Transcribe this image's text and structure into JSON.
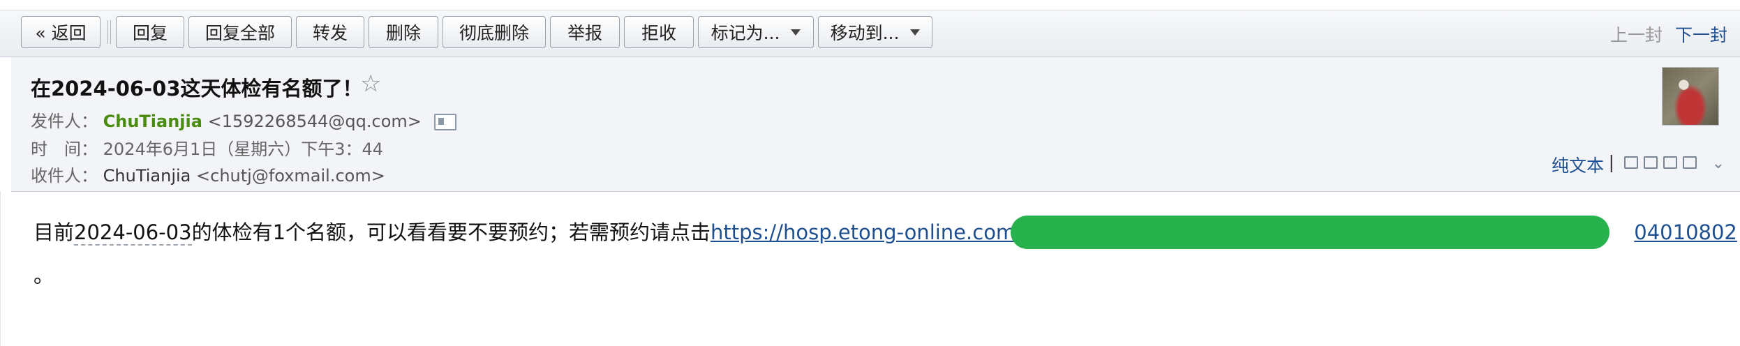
{
  "toolbar": {
    "back_label": "« 返回",
    "reply_label": "回复",
    "reply_all_label": "回复全部",
    "forward_label": "转发",
    "delete_label": "删除",
    "delete_forever_label": "彻底删除",
    "report_label": "举报",
    "reject_label": "拒收",
    "mark_as_label": "标记为...",
    "move_to_label": "移动到...",
    "prev_label": "上一封",
    "next_label": "下一封"
  },
  "email": {
    "subject": "在2024-06-03这天体检有名额了！",
    "sender_label": "发件人：",
    "sender_name": "ChuTianjia",
    "sender_address": "<1592268544@qq.com>",
    "time_label": "时　间：",
    "time_value": "2024年6月1日（星期六）下午3：44",
    "recipient_label": "收件人：",
    "recipient_name": "ChuTianjia",
    "recipient_address": "<chutj@foxmail.com>",
    "plain_text_label": "纯文本",
    "pipe": "|",
    "body_prefix": "目前",
    "body_date": "2024-06-03",
    "body_middle": "的体检有1个名额，可以看看要不要预约；若需预约请点击",
    "link_start": "https://hosp.etong-online.com/#",
    "link_end": "04010802",
    "body_tail": "。"
  },
  "colors": {
    "sender_green": "#4a8c0f",
    "link_blue": "#1e4f91",
    "redaction_green": "#27b24e"
  }
}
